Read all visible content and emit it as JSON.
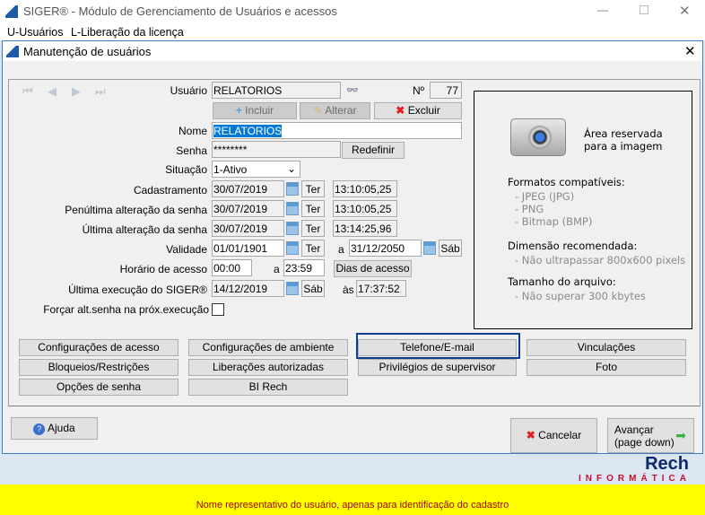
{
  "app": {
    "title": "SIGER® - Módulo de Gerenciamento de Usuários e acessos",
    "menu": [
      "U-Usuários",
      "L-Liberação da licença"
    ]
  },
  "dialog": {
    "title": "Manutenção de usuários"
  },
  "form": {
    "usuario_label": "Usuário",
    "usuario": "RELATORIOS",
    "numero_label": "Nº",
    "numero": "77",
    "incluir": "Incluir",
    "alterar": "Alterar",
    "excluir": "Excluir",
    "nome_label": "Nome",
    "nome": "RELATORIOS",
    "senha_label": "Senha",
    "senha": "********",
    "redefinir": "Redefinir",
    "situacao_label": "Situação",
    "situacao": "1-Ativo",
    "cadastro_label": "Cadastramento",
    "cadastro_data": "30/07/2019",
    "cadastro_dia": "Ter",
    "cadastro_hora": "13:10:05,25",
    "penult_label": "Penúltima alteração da senha",
    "penult_data": "30/07/2019",
    "penult_dia": "Ter",
    "penult_hora": "13:10:05,25",
    "ult_label": "Última alteração da senha",
    "ult_data": "30/07/2019",
    "ult_dia": "Ter",
    "ult_hora": "13:14:25,96",
    "validade_label": "Validade",
    "validade_de": "01/01/1901",
    "validade_de_dia": "Ter",
    "a": "a",
    "validade_ate": "31/12/2050",
    "validade_ate_dia": "Sáb",
    "horario_label": "Horário de acesso",
    "horario_de": "00:00",
    "horario_ate": "23:59",
    "dias_acesso": "Dias de acesso",
    "exec_label": "Última execução do SIGER®",
    "exec_data": "14/12/2019",
    "exec_dia": "Sáb",
    "as": "às",
    "exec_hora": "17:37:52",
    "forcar_label": "Forçar alt.senha na próx.execução",
    "forcar_checked": false
  },
  "image_area": {
    "title1": "Área reservada",
    "title2": "para a imagem",
    "formatos": "Formatos compatíveis:",
    "f1": "- JPEG (JPG)",
    "f2": "- PNG",
    "f3": "- Bitmap (BMP)",
    "dim": "Dimensão recomendada:",
    "dim1": "- Não ultrapassar 800x600 pixels",
    "tam": "Tamanho do arquivo:",
    "tam1": "- Não superar 300 kbytes"
  },
  "buttons": [
    "Configurações de acesso",
    "Configurações de ambiente",
    "Telefone/E-mail",
    "Vinculações",
    "Bloqueios/Restrições",
    "Liberações autorizadas",
    "Privilégios de supervisor",
    "Foto",
    "Opções de senha",
    "BI Rech"
  ],
  "footer": {
    "ajuda": "Ajuda",
    "cancelar": "Cancelar",
    "avancar1": "Avançar",
    "avancar2": "(page down)"
  },
  "logo": {
    "text": "Rech",
    "sub": "INFORMÁTICA"
  },
  "status": "Nome representativo do usuário, apenas para identificação do cadastro",
  "colors": {
    "focus": "#0b3d91",
    "status_bg": "#ffff00",
    "status_text": "#a00000",
    "logo_red": "#c8102e"
  }
}
